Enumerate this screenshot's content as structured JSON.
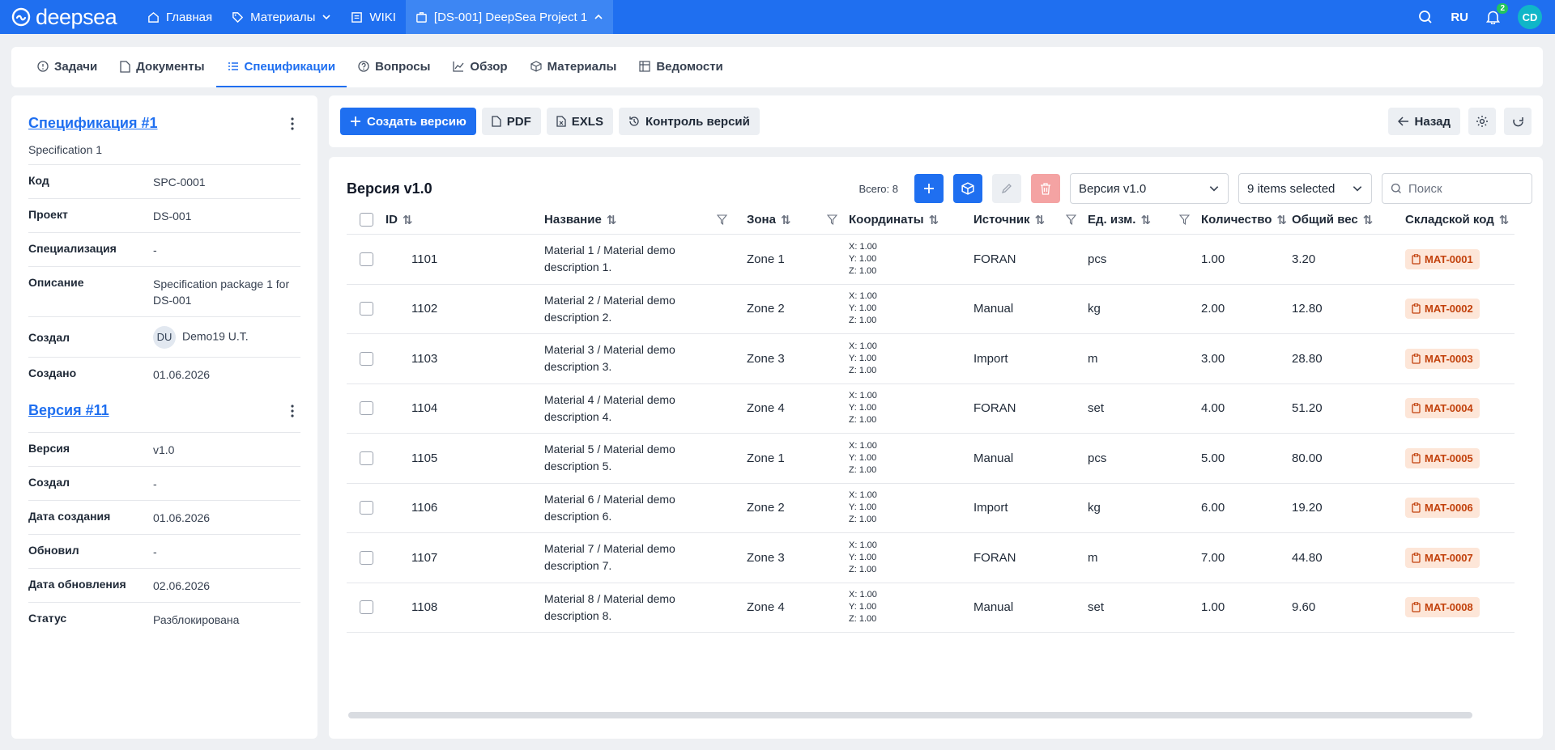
{
  "topbar": {
    "logo": "deepsea",
    "nav": [
      {
        "label": "Главная",
        "icon": "home-icon"
      },
      {
        "label": "Материалы",
        "icon": "tag-icon"
      },
      {
        "label": "WIKI",
        "icon": "book-icon"
      },
      {
        "label": "[DS-001] DeepSea Project 1",
        "icon": "project-icon"
      }
    ],
    "lang": "RU",
    "notifications": "2",
    "user_initials": "CD"
  },
  "tabs": [
    {
      "label": "Задачи",
      "icon": "alert-circle-icon"
    },
    {
      "label": "Документы",
      "icon": "file-icon"
    },
    {
      "label": "Спецификации",
      "icon": "list-icon"
    },
    {
      "label": "Вопросы",
      "icon": "question-icon"
    },
    {
      "label": "Обзор",
      "icon": "chart-icon"
    },
    {
      "label": "Материалы",
      "icon": "cube-icon"
    },
    {
      "label": "Ведомости",
      "icon": "table-icon"
    }
  ],
  "spec": {
    "title": "Спецификация #1",
    "subtitle": "Specification 1",
    "props": [
      {
        "k": "Код",
        "v": "SPC-0001"
      },
      {
        "k": "Проект",
        "v": "DS-001"
      },
      {
        "k": "Специализация",
        "v": "-"
      },
      {
        "k": "Описание",
        "v": "Specification package 1 for DS-001"
      },
      {
        "k": "Создал",
        "v": "Demo19 U.T.",
        "avatar": "DU"
      },
      {
        "k": "Создано",
        "v": "01.06.2026"
      }
    ]
  },
  "version": {
    "title": "Версия #11",
    "props": [
      {
        "k": "Версия",
        "v": "v1.0"
      },
      {
        "k": "Создал",
        "v": "-"
      },
      {
        "k": "Дата создания",
        "v": "01.06.2026"
      },
      {
        "k": "Обновил",
        "v": "-"
      },
      {
        "k": "Дата обновления",
        "v": "02.06.2026"
      },
      {
        "k": "Статус",
        "v": "Разблокирована"
      }
    ]
  },
  "toolbar": {
    "create": "Создать версию",
    "pdf": "PDF",
    "exls": "EXLS",
    "control": "Контроль версий",
    "back": "Назад"
  },
  "table": {
    "title": "Версия v1.0",
    "total": "Всего: 8",
    "version_select": "Версия v1.0",
    "columns_select": "9 items selected",
    "search_placeholder": "Поиск",
    "headers": {
      "id": "ID",
      "name": "Название",
      "zone": "Зона",
      "coord": "Координаты",
      "src": "Источник",
      "unit": "Ед. изм.",
      "qty": "Количество",
      "wt": "Общий вес",
      "code": "Складской код"
    },
    "rows": [
      {
        "id": "1101",
        "name": "Material 1 / Material demo description 1.",
        "zone": "Zone 1",
        "x": "X: 1.00",
        "y": "Y: 1.00",
        "z": "Z: 1.00",
        "src": "FORAN",
        "unit": "pcs",
        "qty": "1.00",
        "wt": "3.20",
        "code": "MAT-0001"
      },
      {
        "id": "1102",
        "name": "Material 2 / Material demo description 2.",
        "zone": "Zone 2",
        "x": "X: 1.00",
        "y": "Y: 1.00",
        "z": "Z: 1.00",
        "src": "Manual",
        "unit": "kg",
        "qty": "2.00",
        "wt": "12.80",
        "code": "MAT-0002"
      },
      {
        "id": "1103",
        "name": "Material 3 / Material demo description 3.",
        "zone": "Zone 3",
        "x": "X: 1.00",
        "y": "Y: 1.00",
        "z": "Z: 1.00",
        "src": "Import",
        "unit": "m",
        "qty": "3.00",
        "wt": "28.80",
        "code": "MAT-0003"
      },
      {
        "id": "1104",
        "name": "Material 4 / Material demo description 4.",
        "zone": "Zone 4",
        "x": "X: 1.00",
        "y": "Y: 1.00",
        "z": "Z: 1.00",
        "src": "FORAN",
        "unit": "set",
        "qty": "4.00",
        "wt": "51.20",
        "code": "MAT-0004"
      },
      {
        "id": "1105",
        "name": "Material 5 / Material demo description 5.",
        "zone": "Zone 1",
        "x": "X: 1.00",
        "y": "Y: 1.00",
        "z": "Z: 1.00",
        "src": "Manual",
        "unit": "pcs",
        "qty": "5.00",
        "wt": "80.00",
        "code": "MAT-0005"
      },
      {
        "id": "1106",
        "name": "Material 6 / Material demo description 6.",
        "zone": "Zone 2",
        "x": "X: 1.00",
        "y": "Y: 1.00",
        "z": "Z: 1.00",
        "src": "Import",
        "unit": "kg",
        "qty": "6.00",
        "wt": "19.20",
        "code": "MAT-0006"
      },
      {
        "id": "1107",
        "name": "Material 7 / Material demo description 7.",
        "zone": "Zone 3",
        "x": "X: 1.00",
        "y": "Y: 1.00",
        "z": "Z: 1.00",
        "src": "FORAN",
        "unit": "m",
        "qty": "7.00",
        "wt": "44.80",
        "code": "MAT-0007"
      },
      {
        "id": "1108",
        "name": "Material 8 / Material demo description 8.",
        "zone": "Zone 4",
        "x": "X: 1.00",
        "y": "Y: 1.00",
        "z": "Z: 1.00",
        "src": "Manual",
        "unit": "set",
        "qty": "1.00",
        "wt": "9.60",
        "code": "MAT-0008"
      }
    ]
  }
}
